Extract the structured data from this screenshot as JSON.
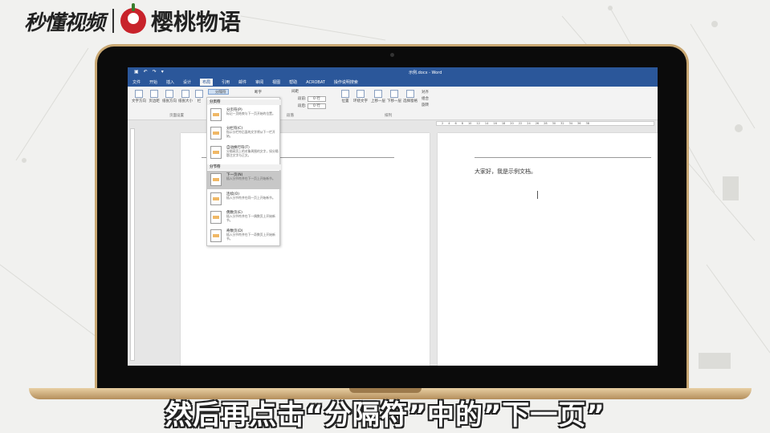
{
  "watermark": {
    "left_text": "秒懂视频",
    "right_text": "樱桃物语"
  },
  "word": {
    "title": "示例.docx - Word",
    "menu": [
      "文件",
      "开始",
      "插入",
      "设计",
      "布局",
      "引用",
      "邮件",
      "审阅",
      "视图",
      "帮助",
      "ACROBAT",
      "操作说明搜索"
    ],
    "active_menu": "布局",
    "ribbon": {
      "text_direction": "文字方向",
      "margins": "页边距",
      "orientation": "纸张方向",
      "size": "纸张大小",
      "columns": "栏",
      "breaks": "分隔符",
      "line_numbers": "行号",
      "hyphenation": "断字",
      "indent": "缩进",
      "spacing": "间距",
      "before": "段前:",
      "before_value": "0 行",
      "after": "段后:",
      "after_value": "0 行",
      "position": "位置",
      "wrap_text": "环绕文字",
      "bring_forward": "上移一层",
      "send_backward": "下移一层",
      "selection_pane": "选择窗格",
      "align": "对齐",
      "group": "组合",
      "rotate": "旋转",
      "group_page_setup": "页面设置",
      "group_paragraph": "段落",
      "group_arrange": "排列"
    },
    "document_text": "大家好，我是示例文档。",
    "dropdown": {
      "section_page": "分页符",
      "section_section": "分节符",
      "items": [
        {
          "label": "分页符(P)",
          "desc": "标记一页结束与下一页开始的位置。"
        },
        {
          "label": "分栏符(C)",
          "desc": "指示分栏符后面的文字将从下一栏开始。"
        },
        {
          "label": "自动换行符(T)",
          "desc": "分隔网页上的对象周围的文字，如分隔题注文字与正文。"
        },
        {
          "label": "下一页(N)",
          "desc": "插入分节符并在下一页上开始新节。"
        },
        {
          "label": "连续(O)",
          "desc": "插入分节符并在同一页上开始新节。"
        },
        {
          "label": "偶数页(E)",
          "desc": "插入分节符并在下一偶数页上开始新节。"
        },
        {
          "label": "奇数页(D)",
          "desc": "插入分节符并在下一奇数页上开始新节。"
        }
      ],
      "highlighted_index": 3
    }
  },
  "subtitle": "然后再点击“分隔符”中的”下一页”"
}
